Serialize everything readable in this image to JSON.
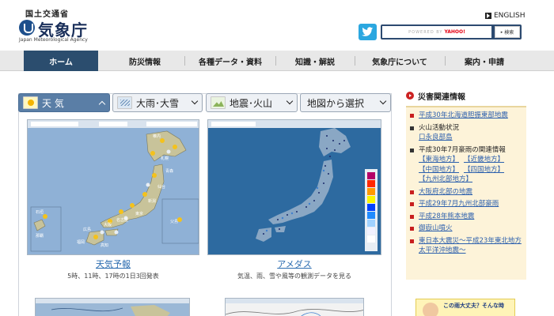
{
  "header": {
    "logo_top": "国土交通省",
    "logo_main": "気象庁",
    "logo_sub": "Japan Meteorological Agency",
    "lang_link": "ENGLISH",
    "search_placeholder": "POWERED BY",
    "search_brand": "YAHOO!",
    "search_button": "検索"
  },
  "nav": {
    "items": [
      "ホーム",
      "防災情報",
      "各種データ・資料",
      "知識・解説",
      "気象庁について",
      "案内・申請"
    ]
  },
  "tabs": [
    {
      "label": "天 気",
      "icon": "sun-icon"
    },
    {
      "label": "大雨･大雪",
      "icon": "rain-icon"
    },
    {
      "label": "地震･火山",
      "icon": "quake-icon"
    },
    {
      "label": "地図から選択",
      "icon": ""
    }
  ],
  "maps": [
    {
      "caption": "天気予報",
      "desc": "5時、11時、17時の1日3回発表"
    },
    {
      "caption": "アメダス",
      "desc": "気温、雨、雪や風等の観測データを見る"
    }
  ],
  "sidebar": {
    "title": "災害関連情報",
    "items": [
      {
        "text": "平成30年北海道胆振東部地震",
        "link": true
      },
      {
        "text": "火山活動状況",
        "link": false,
        "sub": "口永良部島"
      },
      {
        "text": "平成30年7月豪雨の関連情報",
        "link": false,
        "subs": [
          [
            "【東海地方】",
            "【近畿地方】"
          ],
          [
            "【中国地方】",
            "【四国地方】"
          ],
          [
            "【九州北部地方】"
          ]
        ]
      },
      {
        "text": "大阪府北部の地震",
        "link": true
      },
      {
        "text": "平成29年7月九州北部豪雨",
        "link": true
      },
      {
        "text": "平成28年熊本地震",
        "link": true
      },
      {
        "text": "御嶽山噴火",
        "link": true
      },
      {
        "text": "東日本大震災～平成23年東北地方太平洋沖地震～",
        "link": true
      }
    ]
  },
  "banner": {
    "text": "この雨大丈夫？そんな時"
  },
  "colors": {
    "nav_active": "#2b4d6e",
    "tab_active": "#5a7ea6",
    "link": "#2b5fad",
    "alert_red": "#c81e1e",
    "sidebar_bg": "#fdf3d9",
    "twitter": "#2ba7e0"
  }
}
